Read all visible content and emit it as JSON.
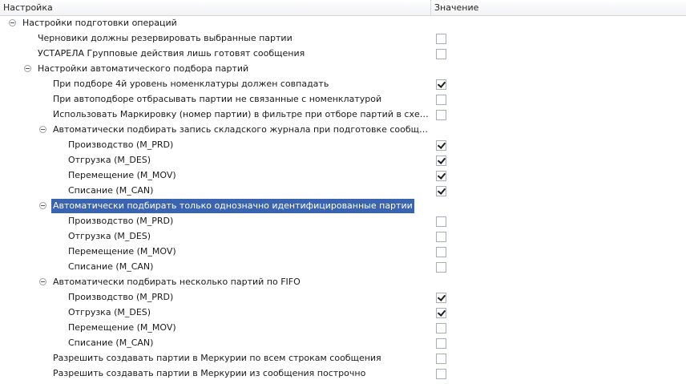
{
  "header": {
    "name_col": "Настройка",
    "value_col": "Значение"
  },
  "rows": [
    {
      "label": "Настройки подготовки операций",
      "level": 0,
      "group": true,
      "expanded": true
    },
    {
      "label": "Черновики должны резервировать выбранные партии",
      "level": 1,
      "group": false,
      "checked": false
    },
    {
      "label": "УСТАРЕЛА Групповые действия лишь готовят сообщения",
      "level": 1,
      "group": false,
      "checked": false
    },
    {
      "label": "Настройки автоматического подбора партий",
      "level": 1,
      "group": true,
      "expanded": true
    },
    {
      "label": "При подборе 4й уровень номенклатуры должен совпадать",
      "level": 2,
      "group": false,
      "checked": true
    },
    {
      "label": "При автоподборе отбрасывать партии не связанные с номенклатурой",
      "level": 2,
      "group": false,
      "checked": false
    },
    {
      "label": "Использовать Маркировку (номер партии) в фильтре при отборе партий в схеме \"Пр...",
      "level": 2,
      "group": false,
      "checked": false
    },
    {
      "label": "Автоматически подбирать запись складского журнала при подготовке сообщения",
      "level": 2,
      "group": true,
      "expanded": true
    },
    {
      "label": "Производство (M_PRD)",
      "level": 3,
      "group": false,
      "checked": true
    },
    {
      "label": "Отгрузка (M_DES)",
      "level": 3,
      "group": false,
      "checked": true
    },
    {
      "label": "Перемещение (M_MOV)",
      "level": 3,
      "group": false,
      "checked": true
    },
    {
      "label": "Списание (M_CAN)",
      "level": 3,
      "group": false,
      "checked": true
    },
    {
      "label": "Автоматически подбирать только однозначно идентифицированные партии",
      "level": 2,
      "group": true,
      "expanded": true,
      "selected": true
    },
    {
      "label": "Производство (M_PRD)",
      "level": 3,
      "group": false,
      "checked": false
    },
    {
      "label": "Отгрузка (M_DES)",
      "level": 3,
      "group": false,
      "checked": false
    },
    {
      "label": "Перемещение (M_MOV)",
      "level": 3,
      "group": false,
      "checked": false
    },
    {
      "label": "Списание (M_CAN)",
      "level": 3,
      "group": false,
      "checked": false
    },
    {
      "label": "Автоматически подбирать несколько партий по FIFO",
      "level": 2,
      "group": true,
      "expanded": true
    },
    {
      "label": "Производство (M_PRD)",
      "level": 3,
      "group": false,
      "checked": true
    },
    {
      "label": "Отгрузка (M_DES)",
      "level": 3,
      "group": false,
      "checked": true
    },
    {
      "label": "Перемещение (M_MOV)",
      "level": 3,
      "group": false,
      "checked": false
    },
    {
      "label": "Списание (M_CAN)",
      "level": 3,
      "group": false,
      "checked": false
    },
    {
      "label": "Разрешить создавать партии в Меркурии по всем строкам сообщения",
      "level": 2,
      "group": false,
      "checked": false
    },
    {
      "label": "Разрешить создавать партии в Меркурии из сообщения построчно",
      "level": 2,
      "group": false,
      "checked": false
    }
  ]
}
